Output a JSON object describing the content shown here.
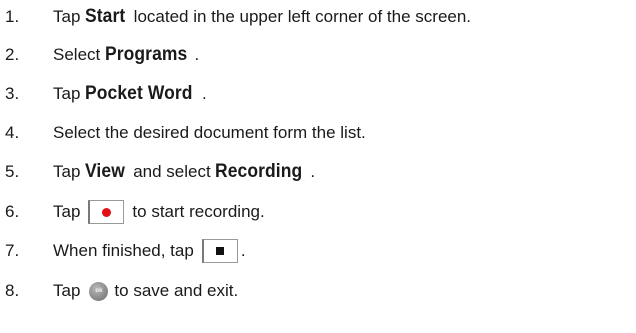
{
  "steps": [
    {
      "number": "1.",
      "pre": "Tap ",
      "kw": "Start",
      "post": " located in the upper left corner of the screen."
    },
    {
      "number": "2.",
      "pre": "Select ",
      "kw": "Programs",
      "post": "."
    },
    {
      "number": "3.",
      "pre": "Tap ",
      "kw": "Pocket Word",
      "post": "."
    },
    {
      "number": "4.",
      "text": "Select the desired document form the list."
    },
    {
      "number": "5.",
      "pre": "Tap ",
      "kw": "View",
      "mid": " and select ",
      "kw2": "Recording",
      "post": "."
    },
    {
      "number": "6.",
      "pre": "Tap",
      "post": "to start recording.",
      "icon": "record-icon"
    },
    {
      "number": "7.",
      "pre": "When finished, tap",
      "post": ".",
      "icon": "stop-icon"
    },
    {
      "number": "8.",
      "pre": "Tap",
      "post": "to save and exit.",
      "icon": "ok-button-icon",
      "icon_label": "ok"
    }
  ],
  "colors": {
    "record": "#e01016",
    "text": "#1a1a1a"
  }
}
